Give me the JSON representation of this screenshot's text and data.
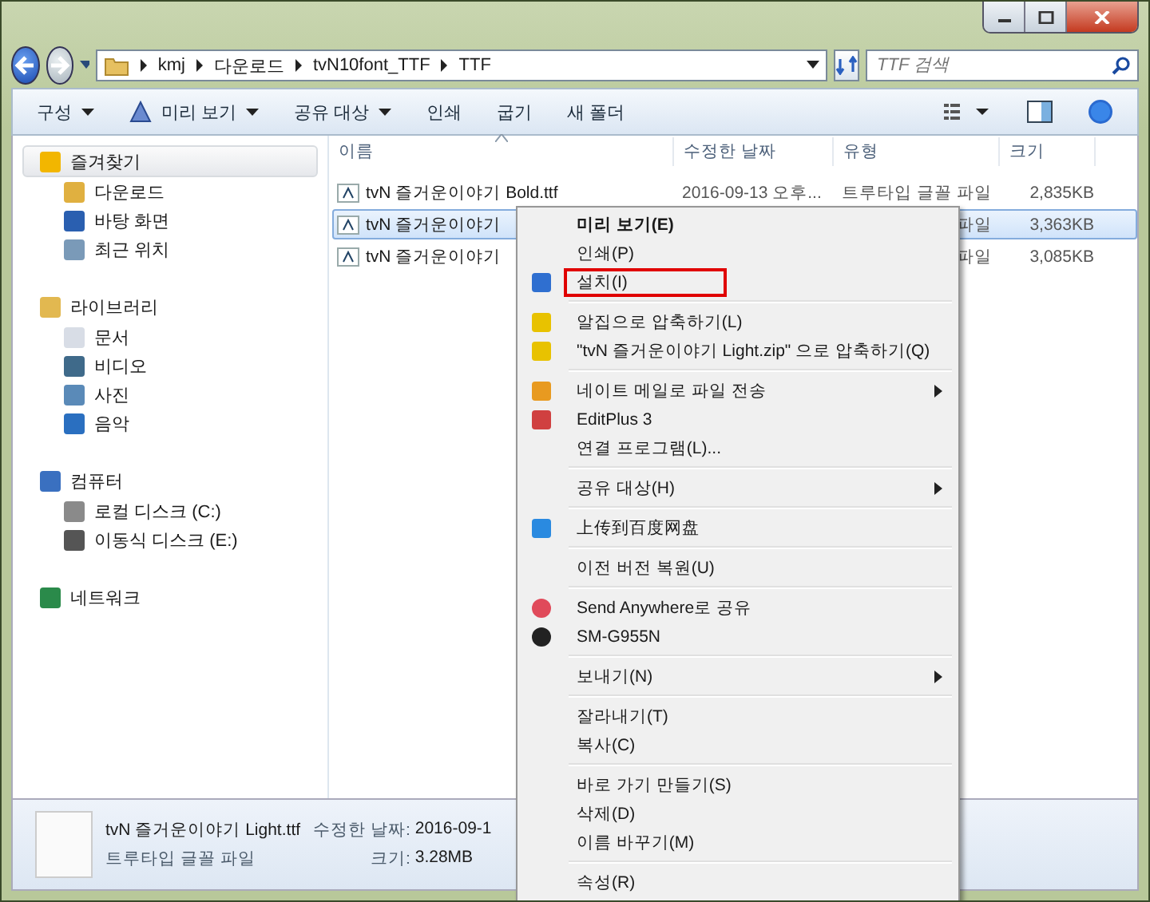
{
  "address": {
    "crumbs": [
      "kmj",
      "다운로드",
      "tvN10font_TTF",
      "TTF"
    ]
  },
  "search": {
    "placeholder": "TTF 검색"
  },
  "toolbar": {
    "items": [
      {
        "label": "구성",
        "dropdown": true
      },
      {
        "label": "미리 보기",
        "dropdown": true
      },
      {
        "label": "공유 대상",
        "dropdown": true
      },
      {
        "label": "인쇄",
        "dropdown": false
      },
      {
        "label": "굽기",
        "dropdown": false
      },
      {
        "label": "새 폴더",
        "dropdown": false
      }
    ]
  },
  "sidebar": {
    "groups": [
      {
        "label": "즐겨찾기",
        "selected": true,
        "children": [
          {
            "label": "다운로드"
          },
          {
            "label": "바탕 화면"
          },
          {
            "label": "최근 위치"
          }
        ]
      },
      {
        "label": "라이브러리",
        "selected": false,
        "children": [
          {
            "label": "문서"
          },
          {
            "label": "비디오"
          },
          {
            "label": "사진"
          },
          {
            "label": "음악"
          }
        ]
      },
      {
        "label": "컴퓨터",
        "selected": false,
        "children": [
          {
            "label": "로컬 디스크 (C:)"
          },
          {
            "label": "이동식 디스크 (E:)"
          }
        ]
      },
      {
        "label": "네트워크",
        "selected": false
      }
    ]
  },
  "table": {
    "columns": [
      {
        "label": "이름",
        "sorted": true
      },
      {
        "label": "수정한 날짜",
        "sorted": false
      },
      {
        "label": "유형",
        "sorted": false
      },
      {
        "label": "크기",
        "sorted": false
      }
    ],
    "rows": [
      {
        "name": "tvN 즐거운이야기 Bold.ttf",
        "date": "2016-09-13 오후...",
        "type": "트루타입 글꼴 파일",
        "size": "2,835KB",
        "selected": false
      },
      {
        "name": "tvN 즐거운이야기",
        "type": "파일",
        "size": "3,363KB",
        "selected": true
      },
      {
        "name": "tvN 즐거운이야기",
        "type": "파일",
        "size": "3,085KB",
        "selected": false
      }
    ]
  },
  "details": {
    "name": "tvN 즐거운이야기 Light.ttf",
    "type": "트루타입 글꼴 파일",
    "fields": [
      {
        "label": "수정한 날짜:",
        "value": "2016-09-1"
      },
      {
        "label": "크기:",
        "value": "3.28MB"
      }
    ]
  },
  "context_menu": {
    "groups": [
      [
        {
          "label": "미리 보기(E)",
          "default": true,
          "submenu": false,
          "highlighted": false
        },
        {
          "label": "인쇄(P)",
          "default": false,
          "submenu": false,
          "highlighted": false
        },
        {
          "label": "설치(I)",
          "default": false,
          "submenu": false,
          "highlighted": true
        }
      ],
      [
        {
          "label": "알집으로 압축하기(L)",
          "default": false,
          "submenu": false,
          "highlighted": false
        },
        {
          "label": "\"tvN 즐거운이야기 Light.zip\" 으로 압축하기(Q)",
          "default": false,
          "submenu": false,
          "highlighted": false
        }
      ],
      [
        {
          "label": "네이트 메일로 파일 전송",
          "default": false,
          "submenu": true,
          "highlighted": false
        },
        {
          "label": "EditPlus 3",
          "default": false,
          "submenu": false,
          "highlighted": false
        },
        {
          "label": "연결 프로그램(L)...",
          "default": false,
          "submenu": false,
          "highlighted": false
        }
      ],
      [
        {
          "label": "공유 대상(H)",
          "default": false,
          "submenu": true,
          "highlighted": false
        }
      ],
      [
        {
          "label": "上传到百度网盘",
          "default": false,
          "submenu": false,
          "highlighted": false
        }
      ],
      [
        {
          "label": "이전 버전 복원(U)",
          "default": false,
          "submenu": false,
          "highlighted": false
        }
      ],
      [
        {
          "label": "Send Anywhere로 공유",
          "default": false,
          "submenu": false,
          "highlighted": false
        },
        {
          "label": "SM-G955N",
          "default": false,
          "submenu": false,
          "highlighted": false
        }
      ],
      [
        {
          "label": "보내기(N)",
          "default": false,
          "submenu": true,
          "highlighted": false
        }
      ],
      [
        {
          "label": "잘라내기(T)",
          "default": false,
          "submenu": false,
          "highlighted": false
        },
        {
          "label": "복사(C)",
          "default": false,
          "submenu": false,
          "highlighted": false
        }
      ],
      [
        {
          "label": "바로 가기 만들기(S)",
          "default": false,
          "submenu": false,
          "highlighted": false
        },
        {
          "label": "삭제(D)",
          "default": false,
          "submenu": false,
          "highlighted": false
        },
        {
          "label": "이름 바꾸기(M)",
          "default": false,
          "submenu": false,
          "highlighted": false
        }
      ],
      [
        {
          "label": "속성(R)",
          "default": false,
          "submenu": false,
          "highlighted": false
        }
      ]
    ]
  }
}
